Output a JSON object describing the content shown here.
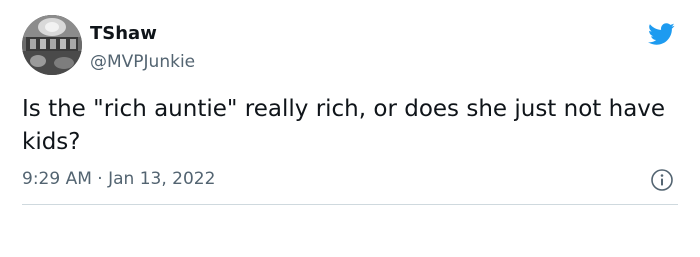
{
  "author": {
    "name": "TShaw",
    "handle": "@MVPJunkie"
  },
  "tweet": {
    "text": "Is the \"rich auntie\" really rich, or does she just not have kids?",
    "time": "9:29 AM",
    "separator": "·",
    "date": "Jan 13, 2022"
  },
  "icons": {
    "logo": "twitter-bird-icon",
    "info": "info-icon"
  },
  "colors": {
    "twitter_blue": "#1d9bf0",
    "text_primary": "#0f1419",
    "text_secondary": "#536471",
    "divider": "#cfd9de"
  }
}
